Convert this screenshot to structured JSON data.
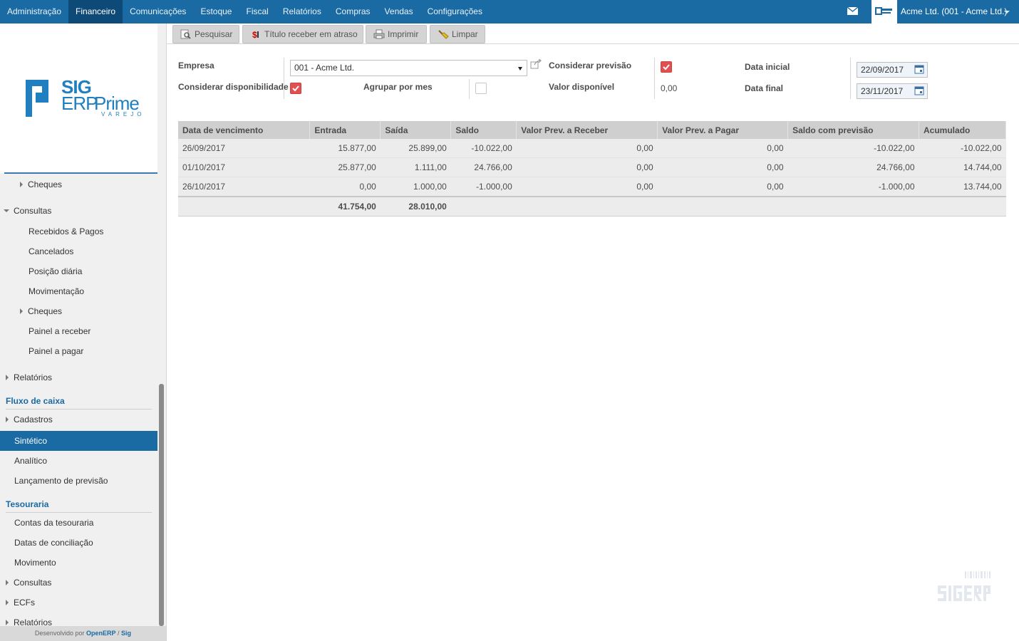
{
  "topbar": {
    "menu": [
      "Administração",
      "Financeiro",
      "Comunicações",
      "Estoque",
      "Fiscal",
      "Relatórios",
      "Compras",
      "Vendas",
      "Configurações"
    ],
    "active": "Financeiro",
    "company": "Acme Ltd. (001 - Acme Ltd.)",
    "accent": "#1a6aa3"
  },
  "sidebar": {
    "logo": {
      "line1": "SIG",
      "line2": "ERP",
      "line3": "Prime",
      "tagline": "VAREJO"
    },
    "items": {
      "cheques_top": "Cheques",
      "consultas": "Consultas",
      "recebidos_pagos": "Recebidos & Pagos",
      "cancelados": "Cancelados",
      "posicao_diaria": "Posição diária",
      "movimentacao": "Movimentação",
      "cheques": "Cheques",
      "painel_receber": "Painel a receber",
      "painel_pagar": "Painel a pagar",
      "relatorios": "Relatórios",
      "fluxo_caixa": "Fluxo de caixa",
      "cadastros": "Cadastros",
      "sintetico": "Sintético",
      "analitico": "Analítico",
      "lancamento_previsao": "Lançamento de previsão",
      "tesouraria": "Tesouraria",
      "contas_tesouraria": "Contas da tesouraria",
      "datas_conciliacao": "Datas de conciliação",
      "movimento": "Movimento",
      "consultas2": "Consultas",
      "ecfs": "ECFs",
      "relatorios2": "Relatórios"
    },
    "footer": {
      "prefix": "Desenvolvido por",
      "link1": "OpenERP",
      "sep": "/",
      "link2": "Sig"
    }
  },
  "toolbar": {
    "pesquisar": "Pesquisar",
    "titulo_atraso": "Título receber em atraso",
    "imprimir": "Imprimir",
    "limpar": "Limpar"
  },
  "form": {
    "empresa_label": "Empresa",
    "empresa_value": "001 - Acme Ltd.",
    "considerar_previsao_label": "Considerar previsão",
    "considerar_previsao": true,
    "data_inicial_label": "Data inicial",
    "data_inicial": "22/09/2017",
    "considerar_disponibilidade_label": "Considerar disponibilidade",
    "considerar_disponibilidade": true,
    "agrupar_mes_label": "Agrupar por mes",
    "agrupar_mes": false,
    "valor_disponivel_label": "Valor disponível",
    "valor_disponivel": "0,00",
    "data_final_label": "Data final",
    "data_final": "23/11/2017"
  },
  "table": {
    "columns": [
      "Data de vencimento",
      "Entrada",
      "Saída",
      "Saldo",
      "Valor Prev. a Receber",
      "Valor Prev. a Pagar",
      "Saldo com previsão",
      "Acumulado"
    ],
    "rows": [
      [
        "26/09/2017",
        "15.877,00",
        "25.899,00",
        "-10.022,00",
        "0,00",
        "0,00",
        "-10.022,00",
        "-10.022,00"
      ],
      [
        "01/10/2017",
        "25.877,00",
        "1.111,00",
        "24.766,00",
        "0,00",
        "0,00",
        "24.766,00",
        "14.744,00"
      ],
      [
        "26/10/2017",
        "0,00",
        "1.000,00",
        "-1.000,00",
        "0,00",
        "0,00",
        "-1.000,00",
        "13.744,00"
      ]
    ],
    "totals": {
      "entrada": "41.754,00",
      "saida": "28.010,00"
    }
  }
}
